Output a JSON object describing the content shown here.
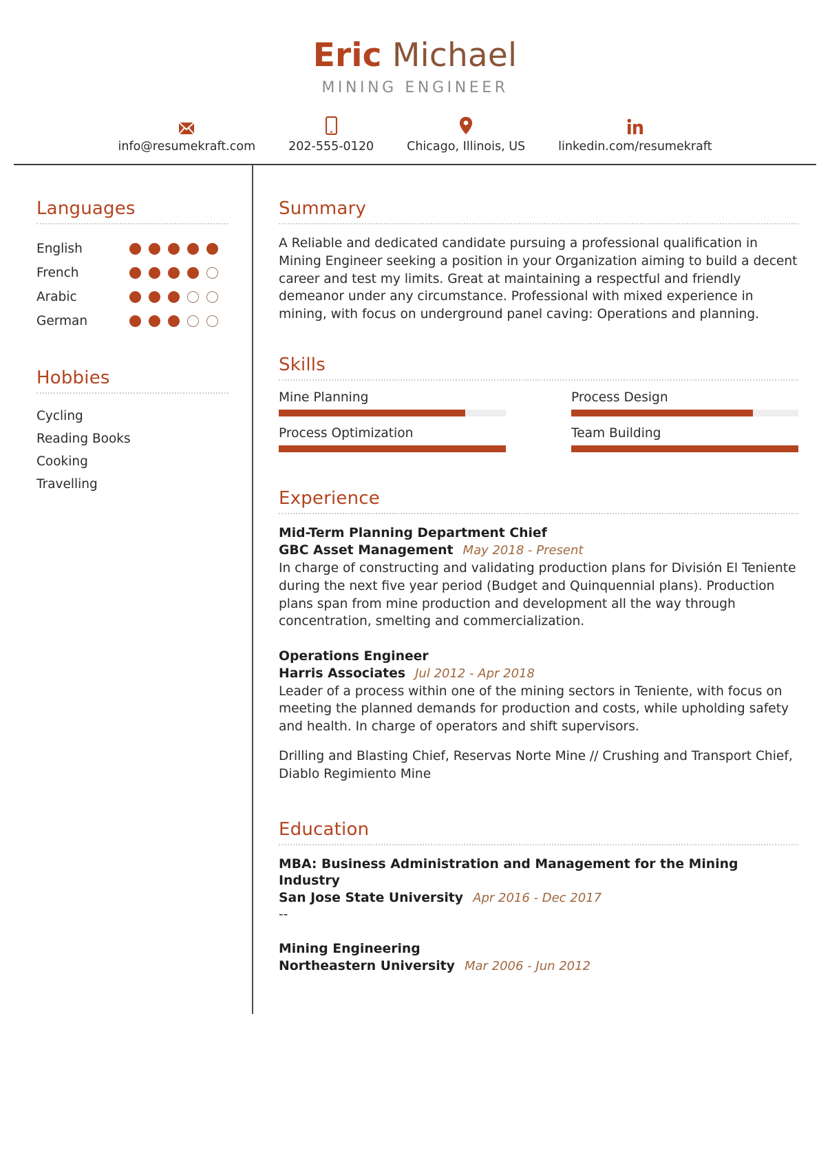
{
  "header": {
    "first_name": "Eric",
    "last_name": "Michael",
    "job_title": "MINING ENGINEER",
    "accent_color": "#b4441f",
    "contacts": [
      {
        "icon": "envelope-icon",
        "text": "info@resumekraft.com"
      },
      {
        "icon": "mobile-phone-icon",
        "text": "202-555-0120"
      },
      {
        "icon": "location-pin-icon",
        "text": "Chicago, Illinois, US"
      },
      {
        "icon": "linkedin-icon",
        "text": "linkedin.com/resumekraft"
      }
    ]
  },
  "sidebar": {
    "languages": {
      "title": "Languages",
      "max_level": 5,
      "items": [
        {
          "label": "English",
          "level": 5
        },
        {
          "label": "French",
          "level": 4
        },
        {
          "label": "Arabic",
          "level": 3
        },
        {
          "label": "German",
          "level": 3
        }
      ]
    },
    "hobbies": {
      "title": "Hobbies",
      "items": [
        {
          "label": "Cycling"
        },
        {
          "label": "Reading Books"
        },
        {
          "label": "Cooking"
        },
        {
          "label": "Travelling"
        }
      ]
    }
  },
  "main": {
    "summary": {
      "title": "Summary",
      "text": "A Reliable and dedicated candidate pursuing a professional qualification in Mining Engineer seeking a position in your Organization aiming to build a decent career and test my limits. Great at maintaining a respectful and friendly demeanor under any circumstance. Professional with mixed experience in mining, with focus on underground panel caving: Operations and planning."
    },
    "skills": {
      "title": "Skills",
      "items": [
        {
          "label": "Mine Planning",
          "percent": 82
        },
        {
          "label": "Process Design",
          "percent": 80
        },
        {
          "label": "Process Optimization",
          "percent": 100
        },
        {
          "label": "Team Building",
          "percent": 100
        }
      ]
    },
    "experience": {
      "title": "Experience",
      "entries": [
        {
          "position": "Mid-Term Planning Department Chief",
          "company": "GBC Asset Management",
          "dates": "May 2018 - Present",
          "description": "In charge of constructing and validating production plans for División El Teniente during the next five year period (Budget and Quinquennial plans). Production plans span from mine production and development all the way through concentration, smelting and commercialization."
        },
        {
          "position": "Operations Engineer",
          "company": "Harris Associates",
          "dates": "Jul 2012 - Apr 2018",
          "description": "Leader of a process within one of the mining sectors in Teniente, with focus on meeting the planned demands for production and costs, while upholding safety and health. In charge of operators and shift supervisors.",
          "extra": "Drilling and Blasting Chief, Reservas Norte Mine // Crushing and Transport Chief, Diablo Regimiento Mine"
        }
      ]
    },
    "education": {
      "title": "Education",
      "entries": [
        {
          "degree": "MBA: Business Administration and Management for the Mining Industry",
          "school": "San Jose State University",
          "dates": "Apr 2016 - Dec 2017",
          "note": "--"
        },
        {
          "degree": "Mining Engineering",
          "school": "Northeastern University",
          "dates": "Mar 2006 - Jun 2012",
          "note": ""
        }
      ]
    }
  }
}
